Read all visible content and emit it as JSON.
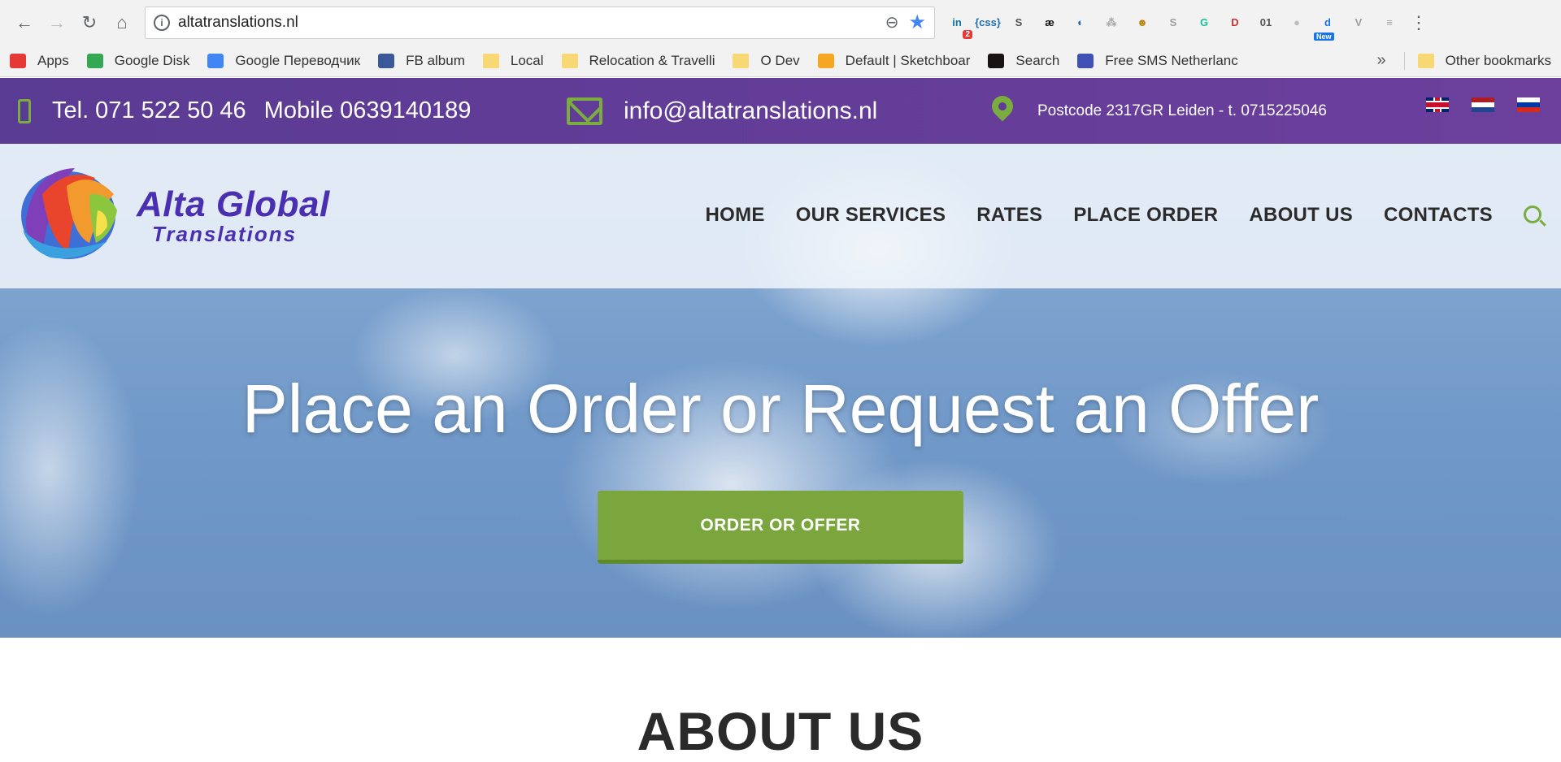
{
  "browser": {
    "url": "altatranslations.nl",
    "extensions": [
      {
        "name": "linkedin-ext-icon",
        "glyph": "in",
        "badge": "2",
        "color": "#0e76a8"
      },
      {
        "name": "css-ext-icon",
        "glyph": "{css}",
        "color": "#1f6fb0"
      },
      {
        "name": "s-ext-icon",
        "glyph": "S",
        "color": "#555555"
      },
      {
        "name": "ae-ext-icon",
        "glyph": "æ",
        "color": "#111111"
      },
      {
        "name": "blue-ext-icon",
        "glyph": "◐",
        "color": "#1565c0"
      },
      {
        "name": "tree-ext-icon",
        "glyph": "⁂",
        "color": "#aaaaaa"
      },
      {
        "name": "face-ext-icon",
        "glyph": "☻",
        "color": "#b8860b"
      },
      {
        "name": "skype-ext-icon",
        "glyph": "S",
        "color": "#9e9e9e"
      },
      {
        "name": "grammarly-ext-icon",
        "glyph": "G",
        "color": "#15c39a"
      },
      {
        "name": "d-ext-icon",
        "glyph": "D",
        "color": "#d32f2f"
      },
      {
        "name": "binary-ext-icon",
        "glyph": "01",
        "color": "#555555"
      },
      {
        "name": "bubble-ext-icon",
        "glyph": "●",
        "color": "#bdbdbd"
      },
      {
        "name": "d-new-ext-icon",
        "glyph": "d",
        "new": "New",
        "color": "#1a73e8"
      },
      {
        "name": "v-ext-icon",
        "glyph": "V",
        "color": "#9e9e9e"
      },
      {
        "name": "db-ext-icon",
        "glyph": "≡",
        "color": "#9e9e9e"
      }
    ]
  },
  "bookmarks": {
    "items": [
      {
        "label": "Apps",
        "icon": "apps-grid-icon",
        "color": "#e53935"
      },
      {
        "label": "Google Disk",
        "icon": "google-drive-icon",
        "color": "#34a853"
      },
      {
        "label": "Google Переводчик",
        "icon": "google-translate-icon",
        "color": "#4285f4"
      },
      {
        "label": "FB album",
        "icon": "facebook-icon",
        "color": "#3b5998"
      },
      {
        "label": "Local",
        "icon": "folder-icon",
        "color": "#f8d775"
      },
      {
        "label": "Relocation & Travelli",
        "icon": "folder-icon",
        "color": "#f8d775"
      },
      {
        "label": "O Dev",
        "icon": "folder-icon",
        "color": "#f8d775"
      },
      {
        "label": "Default | Sketchboar",
        "icon": "sketchboard-icon",
        "color": "#f5a623"
      },
      {
        "label": "Search",
        "icon": "spotify-icon",
        "color": "#191414"
      },
      {
        "label": "Free SMS Netherlanc",
        "icon": "phone-icon",
        "color": "#3f51b5"
      }
    ],
    "more": "»",
    "other": "Other bookmarks"
  },
  "topbar": {
    "phone": "Tel. 071 522 50 46",
    "mobile": "Mobile 0639140189",
    "email": "info@altatranslations.nl",
    "address": "Postcode 2317GR Leiden - t. 0715225046"
  },
  "header": {
    "logo_line1": "Alta Global",
    "logo_line2": "Translations",
    "menu": [
      "HOME",
      "OUR SERVICES",
      "RATES",
      "PLACE ORDER",
      "ABOUT US",
      "CONTACTS"
    ]
  },
  "hero": {
    "title": "Place an Order or Request an Offer",
    "button": "ORDER OR OFFER"
  },
  "about": {
    "title": "ABOUT US"
  },
  "colors": {
    "purple": "#5a3b94",
    "green": "#7aa63d",
    "logo_blue": "#4a2fb0"
  }
}
